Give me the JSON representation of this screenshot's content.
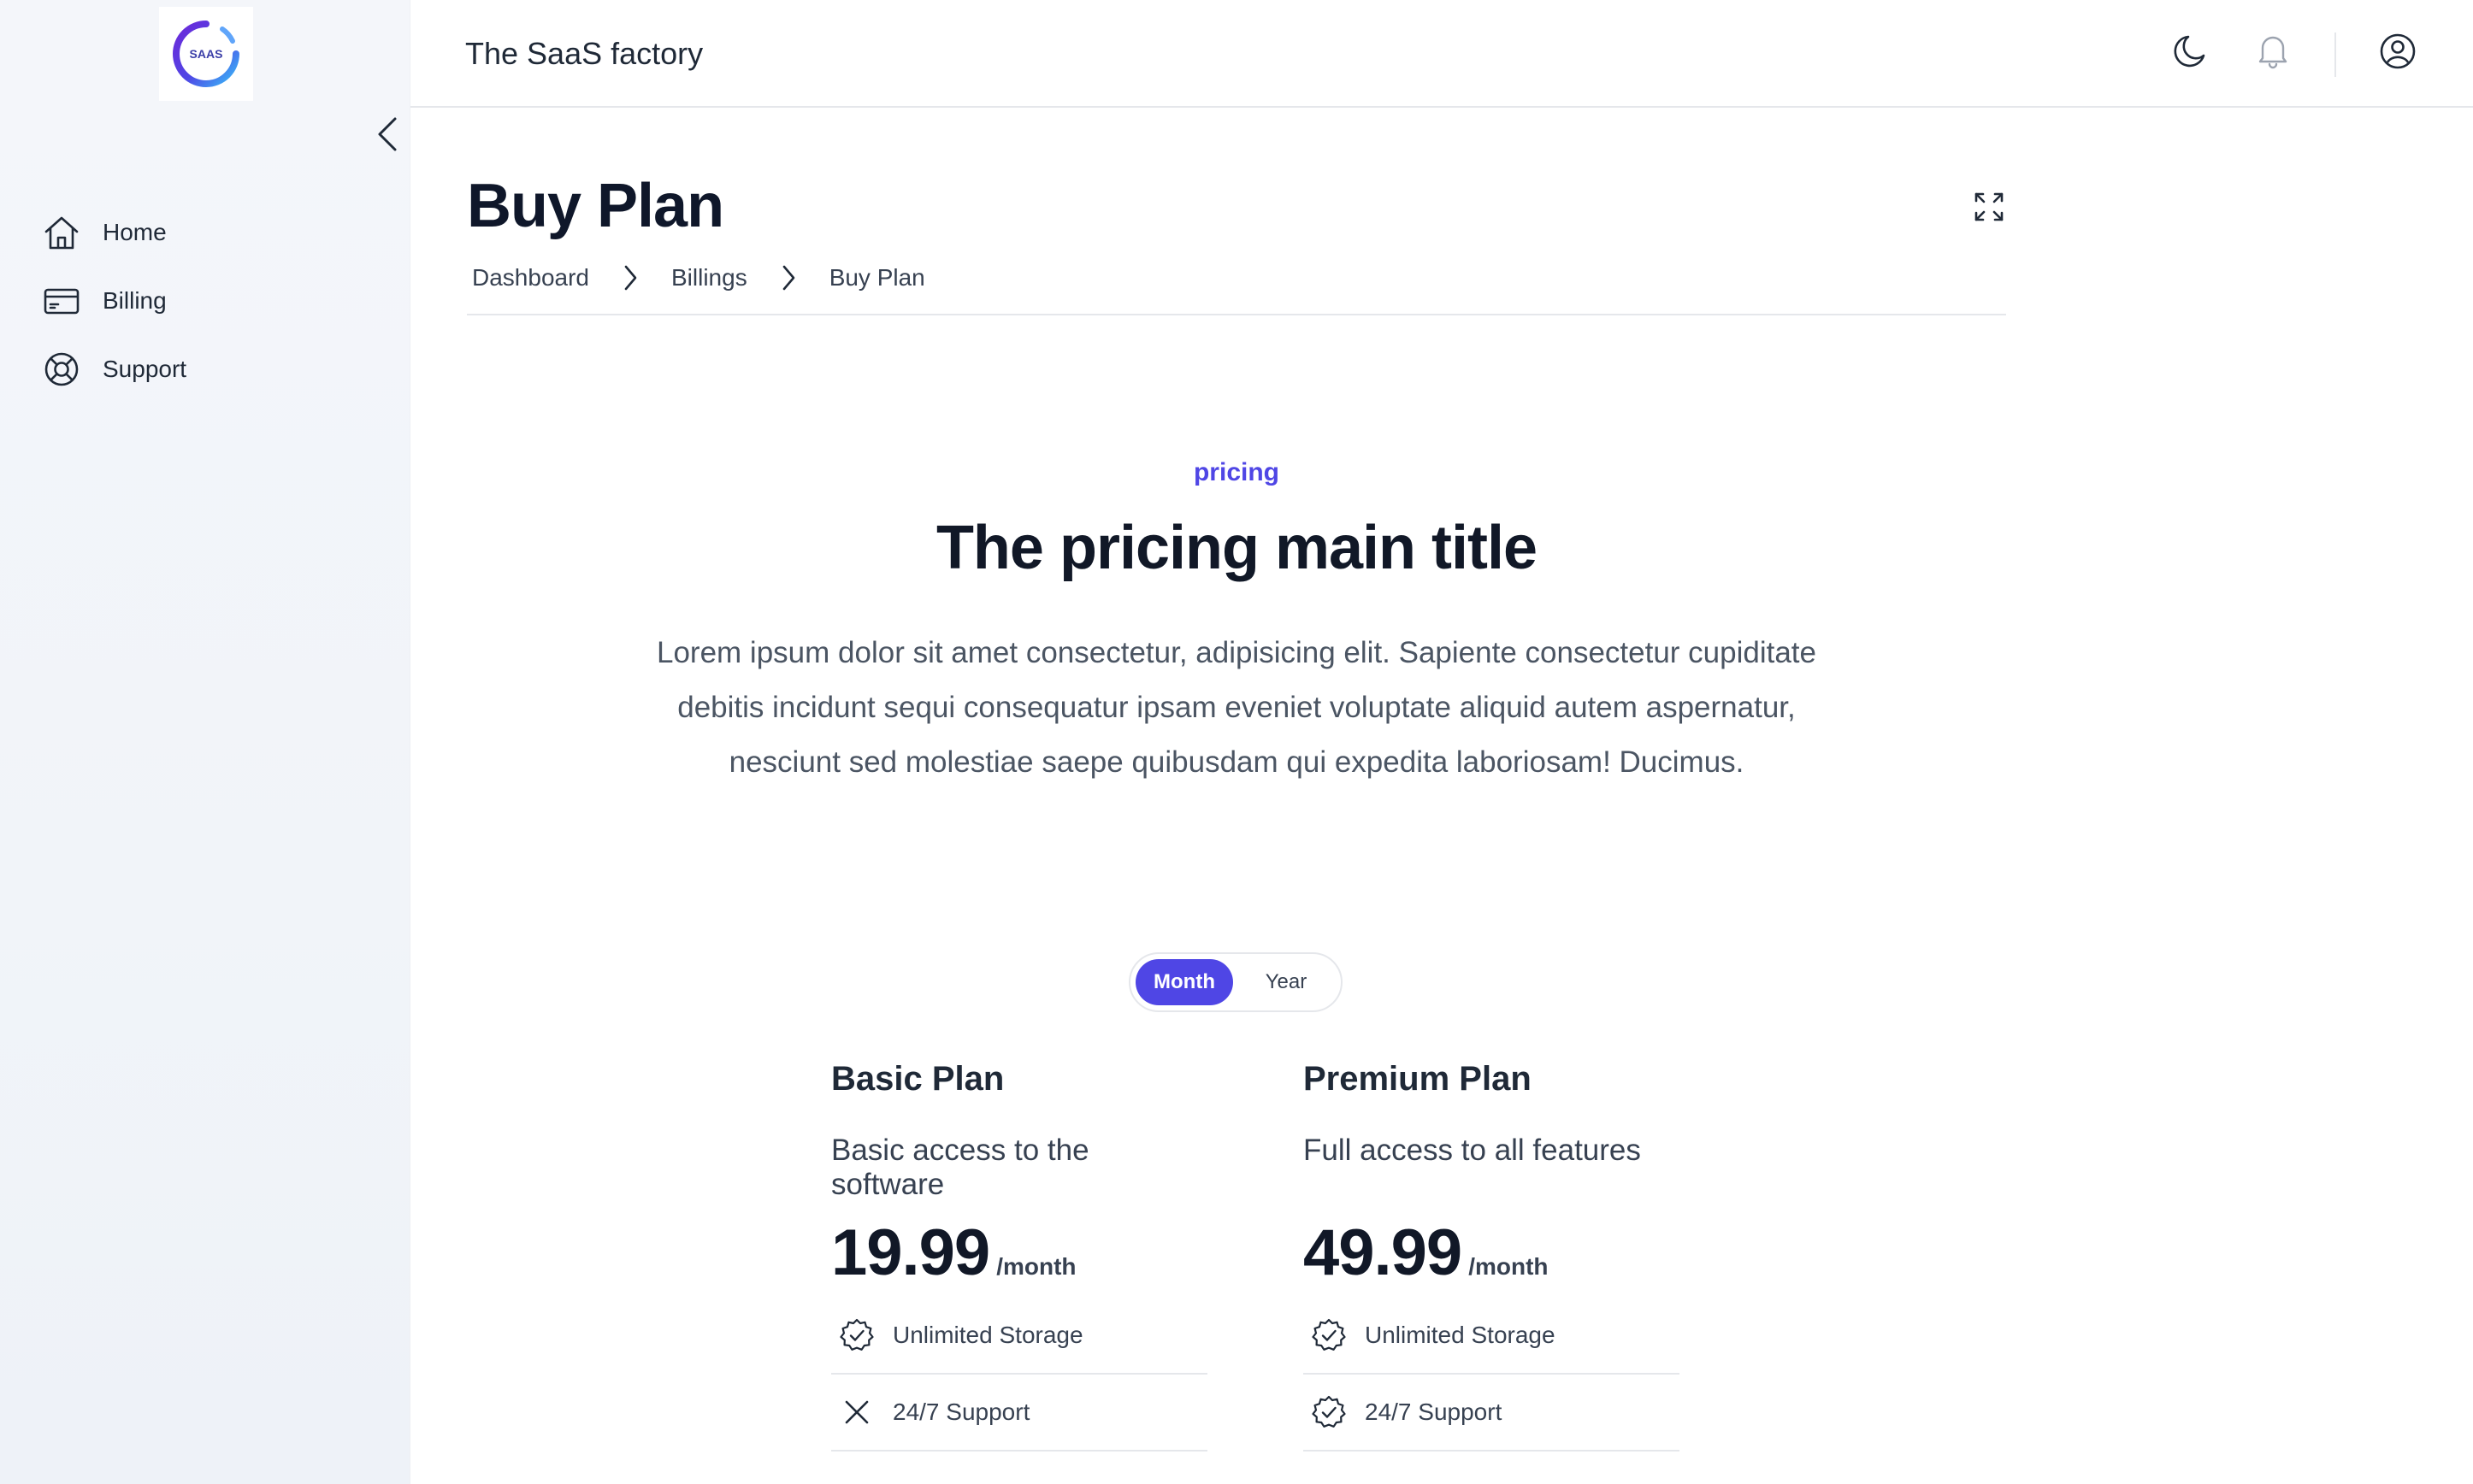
{
  "app": {
    "title": "The SaaS factory",
    "logo_text": "SAAS"
  },
  "sidebar": {
    "items": [
      {
        "label": "Home",
        "icon": "home-icon"
      },
      {
        "label": "Billing",
        "icon": "credit-card-icon"
      },
      {
        "label": "Support",
        "icon": "lifebuoy-icon"
      }
    ]
  },
  "header": {
    "icons": [
      "moon-icon",
      "bell-icon",
      "user-circle-icon"
    ]
  },
  "page": {
    "title": "Buy Plan",
    "breadcrumb": [
      "Dashboard",
      "Billings",
      "Buy Plan"
    ]
  },
  "pricing": {
    "eyebrow": "pricing",
    "title": "The pricing main title",
    "description": "Lorem ipsum dolor sit amet consectetur, adipisicing elit. Sapiente consectetur cupiditate debitis incidunt sequi consequatur ipsam eveniet voluptate aliquid autem aspernatur, nesciunt sed molestiae saepe quibusdam qui expedita laboriosam! Ducimus.",
    "toggle": {
      "month": "Month",
      "year": "Year",
      "selected": "Month"
    },
    "plans": [
      {
        "name": "Basic Plan",
        "description": "Basic access to the software",
        "price": "19.99",
        "period": "/month",
        "features": [
          {
            "label": "Unlimited Storage",
            "included": true
          },
          {
            "label": "24/7 Support",
            "included": false
          }
        ]
      },
      {
        "name": "Premium Plan",
        "description": "Full access to all features",
        "price": "49.99",
        "period": "/month",
        "features": [
          {
            "label": "Unlimited Storage",
            "included": true
          },
          {
            "label": "24/7 Support",
            "included": true
          }
        ]
      }
    ]
  },
  "colors": {
    "accent": "#4f46e5",
    "text": "#111827",
    "muted": "#4b5563",
    "border": "#e5e7eb"
  }
}
